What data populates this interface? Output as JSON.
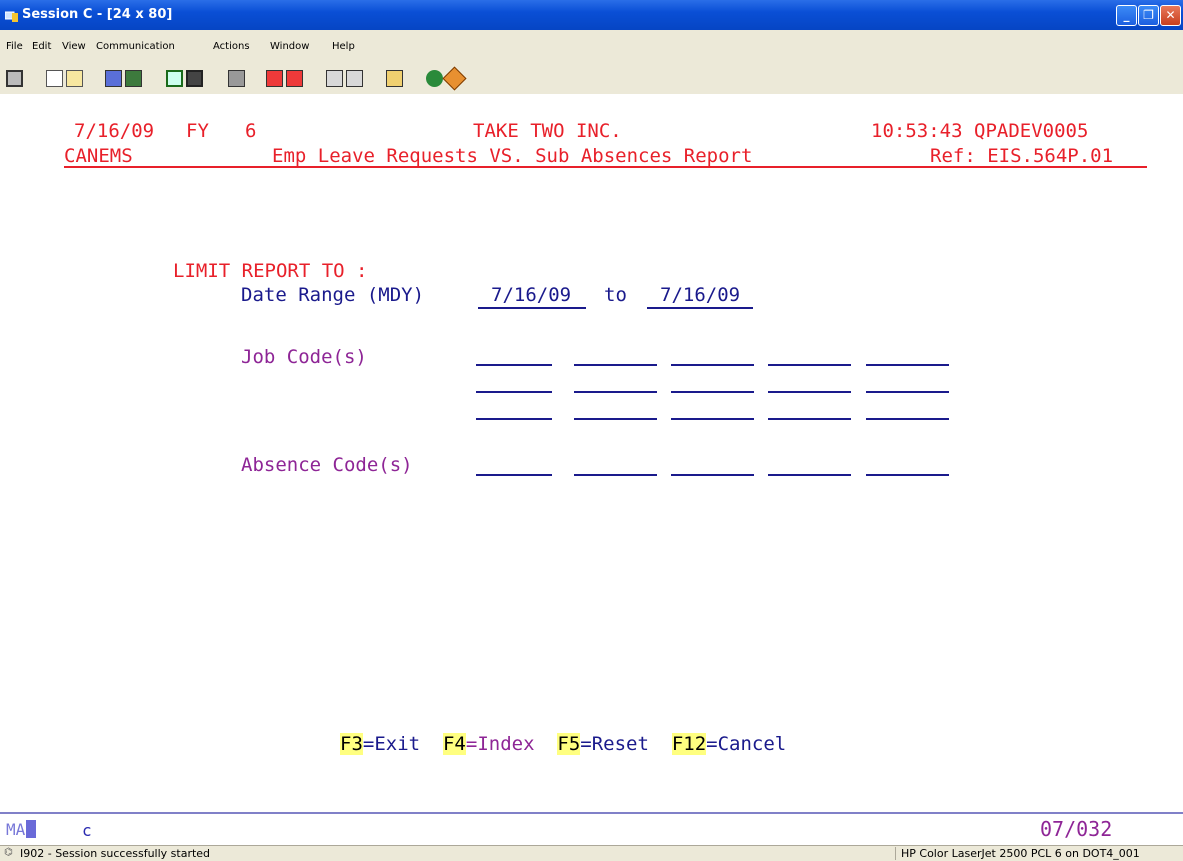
{
  "window": {
    "title": "Session C - [24 x 80]"
  },
  "menu": [
    "File",
    "Edit",
    "View",
    "Communication",
    "Actions",
    "Window",
    "Help"
  ],
  "toolbar_icons": [
    "display-icon",
    "copy-icon",
    "paste-icon",
    "send-icon",
    "receive-icon",
    "screen-icon",
    "monitor-icon",
    "print-icon",
    "record-macro-icon",
    "playback-macro-icon",
    "transfer-icon",
    "transfer-settings-icon",
    "clipboard-icon",
    "globe-icon",
    "help-icon"
  ],
  "header": {
    "date": "7/16/09",
    "fy_label": "FY",
    "fy_value": "6",
    "company": "TAKE TWO INC.",
    "time": "10:53:43",
    "device": "QPADEV0005",
    "program": "CANEMS",
    "report_title": "Emp Leave Requests VS. Sub Absences Report",
    "ref": "Ref: EIS.564P.01"
  },
  "form": {
    "limit_label": "LIMIT REPORT TO :",
    "date_range_label": "Date Range (MDY)",
    "date_from": "7/16/09",
    "to_label": "to",
    "date_to": "7/16/09",
    "job_codes_label": "Job Code(s)",
    "absence_codes_label": "Absence Code(s)"
  },
  "function_keys": [
    {
      "key": "F3",
      "action": "=Exit"
    },
    {
      "key": "F4",
      "action": "=Index"
    },
    {
      "key": "F5",
      "action": "=Reset"
    },
    {
      "key": "F12",
      "action": "=Cancel"
    }
  ],
  "oia": {
    "mode": "MA",
    "indicator": "c",
    "cursor": "07/032"
  },
  "status": {
    "message": "I902 - Session successfully started",
    "printer": "HP Color LaserJet 2500 PCL 6 on DOT4_001"
  },
  "colors": {
    "red": "#e8202a",
    "blue": "#1a1a8c",
    "purple": "#8e2596"
  }
}
